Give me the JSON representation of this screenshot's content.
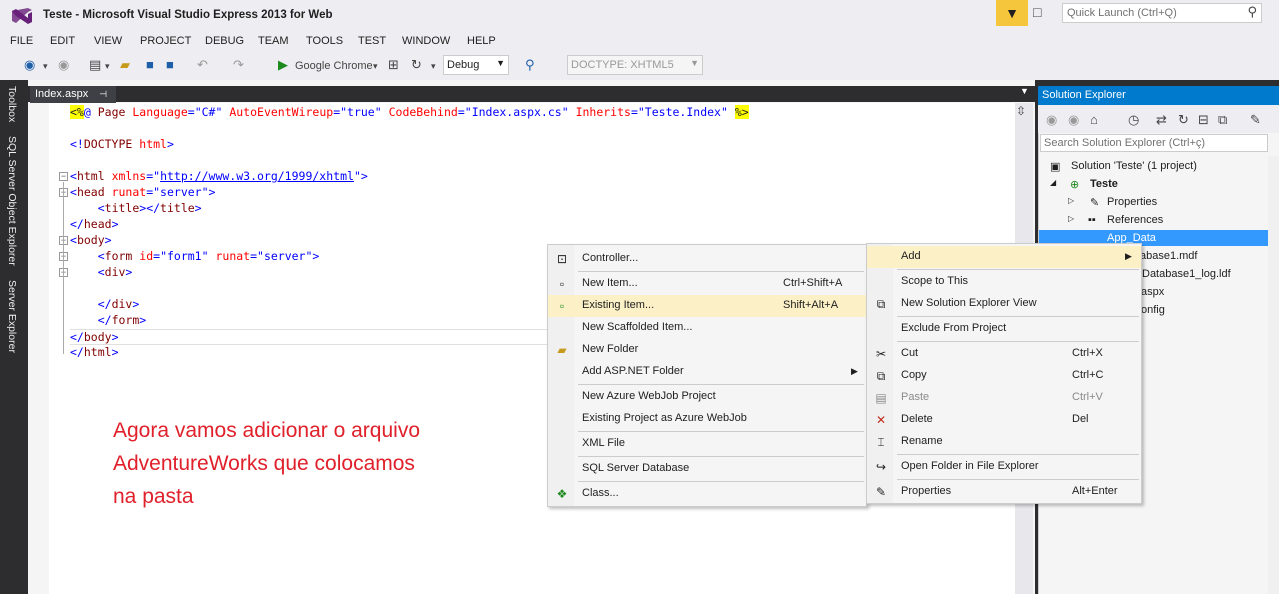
{
  "window": {
    "title": "Teste - Microsoft Visual Studio Express 2013 for Web"
  },
  "quick_launch": {
    "placeholder": "Quick Launch (Ctrl+Q)"
  },
  "menu": [
    "FILE",
    "EDIT",
    "VIEW",
    "PROJECT",
    "DEBUG",
    "TEAM",
    "TOOLS",
    "TEST",
    "WINDOW",
    "HELP"
  ],
  "toolbar": {
    "browser": "Google Chrome",
    "config": "Debug",
    "doctype": "DOCTYPE: XHTML5"
  },
  "side_tabs": [
    "Toolbox",
    "SQL Server Object Explorer",
    "Server Explorer"
  ],
  "editor": {
    "tab": "Index.aspx",
    "lines": [
      "<%@ Page Language=\"C#\" AutoEventWireup=\"true\" CodeBehind=\"Index.aspx.cs\" Inherits=\"Teste.Index\" %>",
      "",
      "<!DOCTYPE html>",
      "",
      "<html xmlns=\"http://www.w3.org/1999/xhtml\">",
      "<head runat=\"server\">",
      "    <title></title>",
      "</head>",
      "<body>",
      "    <form id=\"form1\" runat=\"server\">",
      "    <div>",
      "",
      "    </div>",
      "    </form>",
      "</body>",
      "</html>"
    ]
  },
  "annotation": [
    "Agora vamos adicionar o arquivo",
    "AdventureWorks que colocamos",
    "na pasta"
  ],
  "solution_explorer": {
    "title": "Solution Explorer",
    "search_placeholder": "Search Solution Explorer (Ctrl+ç)",
    "items": [
      "Solution 'Teste' (1 project)",
      "Teste",
      "Properties",
      "References",
      "App_Data",
      "abase1.mdf",
      "Database1_log.ldf",
      "aspx",
      "onfig"
    ]
  },
  "context_menu": {
    "items": [
      {
        "label": "Add",
        "shortcut": ""
      },
      {
        "label": "Scope to This",
        "shortcut": ""
      },
      {
        "label": "New Solution Explorer View",
        "shortcut": ""
      },
      {
        "label": "Exclude From Project",
        "shortcut": ""
      },
      {
        "label": "Cut",
        "shortcut": "Ctrl+X"
      },
      {
        "label": "Copy",
        "shortcut": "Ctrl+C"
      },
      {
        "label": "Paste",
        "shortcut": "Ctrl+V"
      },
      {
        "label": "Delete",
        "shortcut": "Del"
      },
      {
        "label": "Rename",
        "shortcut": ""
      },
      {
        "label": "Open Folder in File Explorer",
        "shortcut": ""
      },
      {
        "label": "Properties",
        "shortcut": "Alt+Enter"
      }
    ]
  },
  "add_submenu": {
    "items": [
      {
        "label": "Controller...",
        "shortcut": ""
      },
      {
        "label": "New Item...",
        "shortcut": "Ctrl+Shift+A"
      },
      {
        "label": "Existing Item...",
        "shortcut": "Shift+Alt+A"
      },
      {
        "label": "New Scaffolded Item...",
        "shortcut": ""
      },
      {
        "label": "New Folder",
        "shortcut": ""
      },
      {
        "label": "Add ASP.NET Folder",
        "shortcut": ""
      },
      {
        "label": "New Azure WebJob Project",
        "shortcut": ""
      },
      {
        "label": "Existing Project as Azure WebJob",
        "shortcut": ""
      },
      {
        "label": "XML File",
        "shortcut": ""
      },
      {
        "label": "SQL Server Database",
        "shortcut": ""
      },
      {
        "label": "Class...",
        "shortcut": ""
      }
    ]
  }
}
